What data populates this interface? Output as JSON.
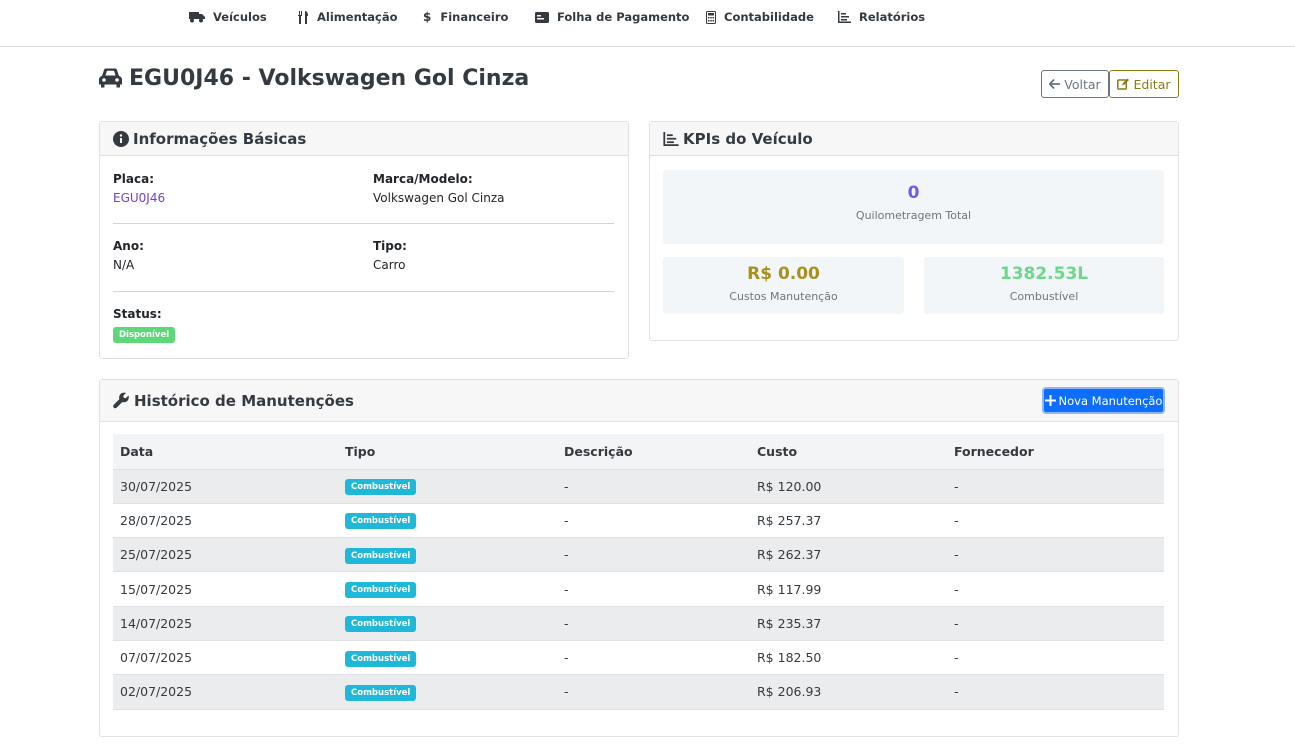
{
  "nav": {
    "items": [
      {
        "label": "Veículos",
        "icon": "truck-icon"
      },
      {
        "label": "Alimentação",
        "icon": "utensils-icon"
      },
      {
        "label": "Financeiro",
        "icon": "dollar-icon"
      },
      {
        "label": "Folha de Pagamento",
        "icon": "id-card-icon"
      },
      {
        "label": "Contabilidade",
        "icon": "calculator-icon"
      },
      {
        "label": "Relatórios",
        "icon": "chart-icon"
      }
    ]
  },
  "header": {
    "title": "EGU0J46 - Volkswagen Gol Cinza",
    "back_label": "Voltar",
    "edit_label": "Editar"
  },
  "info": {
    "title": "Informações Básicas",
    "placa_label": "Placa:",
    "placa_value": "EGU0J46",
    "marca_label": "Marca/Modelo:",
    "marca_value": "Volkswagen Gol Cinza",
    "ano_label": "Ano:",
    "ano_value": "N/A",
    "tipo_label": "Tipo:",
    "tipo_value": "Carro",
    "status_label": "Status:",
    "status_value": "Disponível"
  },
  "kpis": {
    "title": "KPIs do Veículo",
    "km_value": "0",
    "km_label": "Quilometragem Total",
    "maint_value": "R$ 0.00",
    "maint_label": "Custos Manutenção",
    "fuel_value": "1382.53L",
    "fuel_label": "Combustível"
  },
  "history": {
    "title": "Histórico de Manutenções",
    "new_label": "Nova Manutenção",
    "columns": [
      "Data",
      "Tipo",
      "Descrição",
      "Custo",
      "Fornecedor"
    ],
    "rows": [
      {
        "data": "30/07/2025",
        "tipo": "Combustível",
        "descricao": "-",
        "custo": "R$ 120.00",
        "fornecedor": "-"
      },
      {
        "data": "28/07/2025",
        "tipo": "Combustível",
        "descricao": "-",
        "custo": "R$ 257.37",
        "fornecedor": "-"
      },
      {
        "data": "25/07/2025",
        "tipo": "Combustível",
        "descricao": "-",
        "custo": "R$ 262.37",
        "fornecedor": "-"
      },
      {
        "data": "15/07/2025",
        "tipo": "Combustível",
        "descricao": "-",
        "custo": "R$ 117.99",
        "fornecedor": "-"
      },
      {
        "data": "14/07/2025",
        "tipo": "Combustível",
        "descricao": "-",
        "custo": "R$ 235.37",
        "fornecedor": "-"
      },
      {
        "data": "07/07/2025",
        "tipo": "Combustível",
        "descricao": "-",
        "custo": "R$ 182.50",
        "fornecedor": "-"
      },
      {
        "data": "02/07/2025",
        "tipo": "Combustível",
        "descricao": "-",
        "custo": "R$ 206.93",
        "fornecedor": "-"
      }
    ]
  },
  "colors": {
    "primary": "#0d6efd",
    "link": "#6f42c1",
    "warning_text": "#8a7a12",
    "success": "#5dd879",
    "info_badge": "#20b8d8",
    "kpi_km": "#6f5ce6",
    "kpi_maint": "#a8901a",
    "kpi_fuel": "#6ad98a"
  }
}
